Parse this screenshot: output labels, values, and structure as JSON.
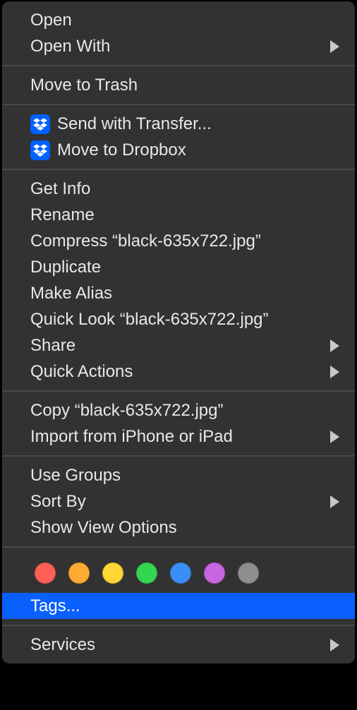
{
  "menu": {
    "groups": [
      [
        {
          "label": "Open",
          "submenu": false,
          "icon": null
        },
        {
          "label": "Open With",
          "submenu": true,
          "icon": null
        }
      ],
      [
        {
          "label": "Move to Trash",
          "submenu": false,
          "icon": null
        }
      ],
      [
        {
          "label": "Send with Transfer...",
          "submenu": false,
          "icon": "dropbox"
        },
        {
          "label": "Move to Dropbox",
          "submenu": false,
          "icon": "dropbox"
        }
      ],
      [
        {
          "label": "Get Info",
          "submenu": false,
          "icon": null
        },
        {
          "label": "Rename",
          "submenu": false,
          "icon": null
        },
        {
          "label": "Compress “black-635x722.jpg”",
          "submenu": false,
          "icon": null
        },
        {
          "label": "Duplicate",
          "submenu": false,
          "icon": null
        },
        {
          "label": "Make Alias",
          "submenu": false,
          "icon": null
        },
        {
          "label": "Quick Look “black-635x722.jpg”",
          "submenu": false,
          "icon": null
        },
        {
          "label": "Share",
          "submenu": true,
          "icon": null
        },
        {
          "label": "Quick Actions",
          "submenu": true,
          "icon": null
        }
      ],
      [
        {
          "label": "Copy “black-635x722.jpg”",
          "submenu": false,
          "icon": null
        },
        {
          "label": "Import from iPhone or iPad",
          "submenu": true,
          "icon": null
        }
      ],
      [
        {
          "label": "Use Groups",
          "submenu": false,
          "icon": null
        },
        {
          "label": "Sort By",
          "submenu": true,
          "icon": null
        },
        {
          "label": "Show View Options",
          "submenu": false,
          "icon": null
        }
      ]
    ],
    "tagColors": [
      "#ff5f57",
      "#ffaa33",
      "#ffd633",
      "#33d651",
      "#3a8ef6",
      "#c865e0",
      "#8e8e8e"
    ],
    "tagsLabel": "Tags...",
    "tagsSelected": true,
    "servicesLabel": "Services",
    "servicesSubmenu": true
  }
}
